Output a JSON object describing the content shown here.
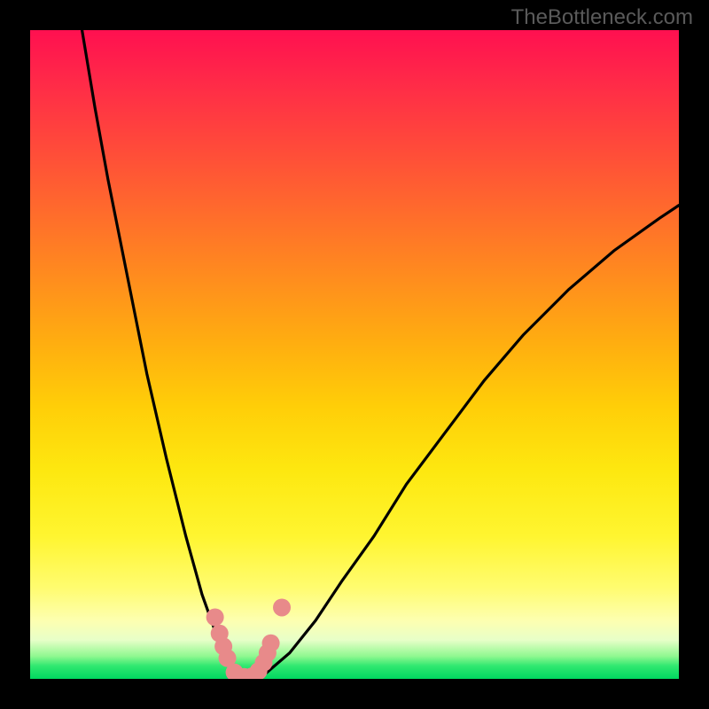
{
  "attribution": "TheBottleneck.com",
  "chart_data": {
    "type": "line",
    "title": "",
    "xlabel": "",
    "ylabel": "",
    "xlim": [
      0,
      100
    ],
    "ylim": [
      0,
      100
    ],
    "background_gradient": {
      "top": "#ff1050",
      "bottom": "#00d860",
      "meaning": "bottleneck severity (red high, green low)"
    },
    "series": [
      {
        "name": "bottleneck-curve",
        "x": [
          8,
          10,
          12,
          15,
          18,
          21,
          24,
          26.5,
          29,
          31,
          33,
          35,
          36.5,
          40,
          44,
          48,
          53,
          58,
          64,
          70,
          76,
          83,
          90,
          97,
          100
        ],
        "y": [
          100,
          88,
          77,
          62,
          47,
          34,
          22,
          13,
          6,
          2,
          0,
          0,
          1,
          4,
          9,
          15,
          22,
          30,
          38,
          46,
          53,
          60,
          66,
          71,
          73
        ],
        "color": "#000000"
      },
      {
        "name": "marker-points",
        "type": "scatter",
        "x": [
          28.5,
          29.2,
          29.8,
          30.4,
          31.5,
          33.0,
          34.2,
          35.2,
          36.0,
          36.6,
          37.1,
          38.8
        ],
        "y": [
          9.5,
          7.0,
          5.0,
          3.2,
          1.0,
          0.3,
          0.4,
          1.2,
          2.5,
          4.0,
          5.5,
          11.0
        ],
        "color": "#e88a8a",
        "marker_size": 10
      }
    ]
  }
}
